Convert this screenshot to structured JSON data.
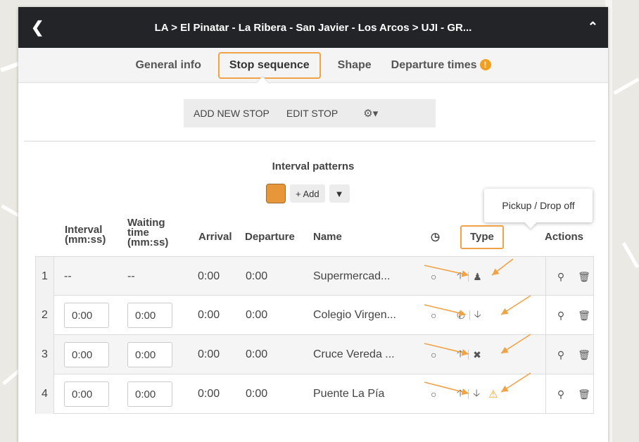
{
  "header": {
    "title": "LA > El Pinatar - La Ribera - San Javier - Los Arcos > UJI - GR...",
    "back_icon": "chevron-left-icon",
    "collapse_icon": "chevron-up-icon"
  },
  "tabs": [
    {
      "label": "General info",
      "active": false
    },
    {
      "label": "Stop sequence",
      "active": true
    },
    {
      "label": "Shape",
      "active": false
    },
    {
      "label": "Departure times",
      "active": false,
      "badge": "!"
    }
  ],
  "toolbar": {
    "add_stop": "ADD NEW STOP",
    "edit_stop": "EDIT STOP",
    "settings_icon": "gear-dropdown-icon"
  },
  "intervals": {
    "title": "Interval patterns",
    "swatch_color": "#e8963a",
    "add_label": "+ Add",
    "filter_icon": "filter-icon"
  },
  "tooltip": {
    "text": "Pickup / Drop off"
  },
  "table": {
    "headers": {
      "interval": "Interval (mm:ss)",
      "waiting": "Waiting time (mm:ss)",
      "arrival": "Arrival",
      "departure": "Departure",
      "name": "Name",
      "timepoint_icon": "clock-icon",
      "type": "Type",
      "actions": "Actions"
    },
    "rows": [
      {
        "index": "1",
        "interval": "--",
        "waiting": "--",
        "arrival": "0:00",
        "departure": "0:00",
        "name": "Supermercad...",
        "pickup": "arrow-up",
        "dropoff": "person",
        "warning": false
      },
      {
        "index": "2",
        "interval": "0:00",
        "waiting": "0:00",
        "arrival": "0:00",
        "departure": "0:00",
        "name": "Colegio Virgen...",
        "pickup": "phone",
        "dropoff": "arrow-down",
        "warning": false
      },
      {
        "index": "3",
        "interval": "0:00",
        "waiting": "0:00",
        "arrival": "0:00",
        "departure": "0:00",
        "name": "Cruce Vereda ...",
        "pickup": "arrow-up",
        "dropoff": "cross",
        "warning": false
      },
      {
        "index": "4",
        "interval": "0:00",
        "waiting": "0:00",
        "arrival": "0:00",
        "departure": "0:00",
        "name": "Puente La Pía",
        "pickup": "arrow-up",
        "dropoff": "arrow-down",
        "warning": true
      }
    ]
  },
  "colors": {
    "accent": "#f0a247",
    "header_bg": "#222428",
    "warning": "#f0a020"
  }
}
